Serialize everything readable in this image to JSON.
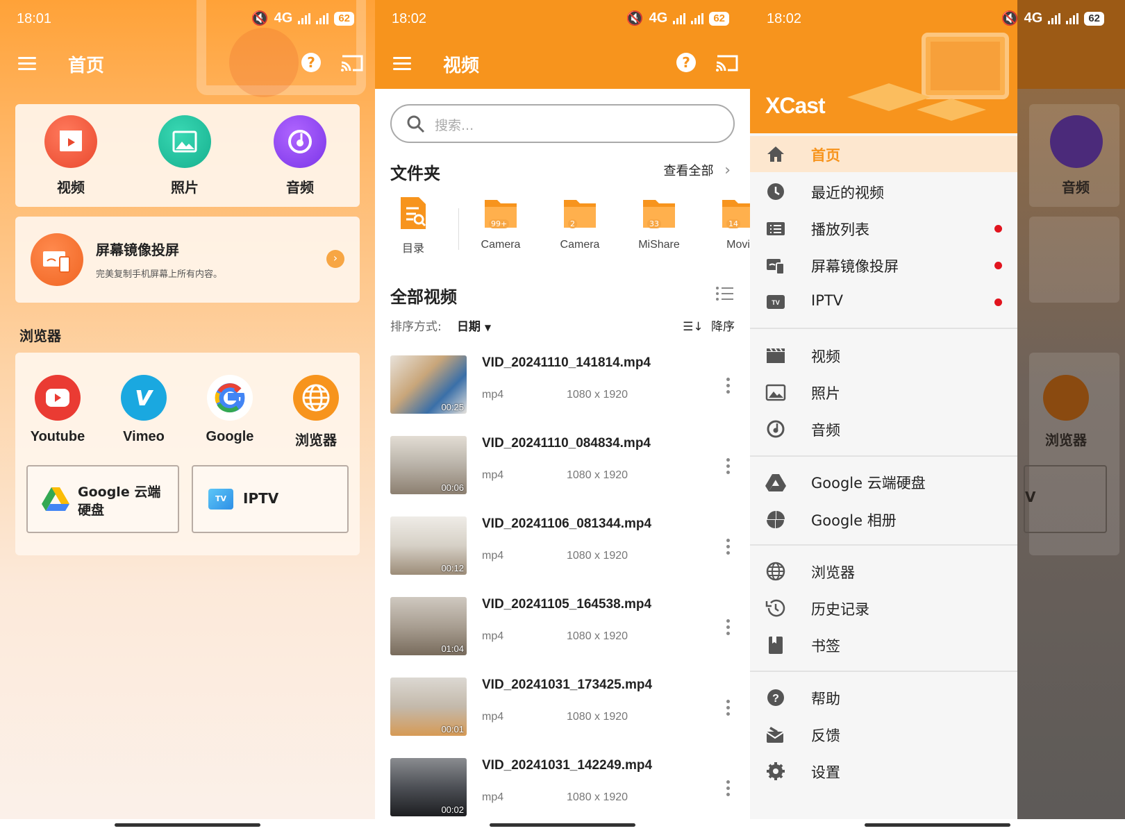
{
  "colors": {
    "accent": "#f7941d",
    "drawer_active_bg": "#fde7cf",
    "red_dot": "#e1141e"
  },
  "panel1": {
    "status": {
      "time": "18:01",
      "network": "4G",
      "battery": "62"
    },
    "title": "首页",
    "quick": [
      {
        "label": "视频",
        "icon": "video-clapper-icon"
      },
      {
        "label": "照片",
        "icon": "photo-icon"
      },
      {
        "label": "音频",
        "icon": "music-icon"
      }
    ],
    "mirror": {
      "title": "屏幕镜像投屏",
      "subtitle": "完美复制手机屏幕上所有内容。"
    },
    "browser_section": "浏览器",
    "browsers": [
      {
        "label": "Youtube",
        "icon": "youtube-icon"
      },
      {
        "label": "Vimeo",
        "icon": "vimeo-icon"
      },
      {
        "label": "Google",
        "icon": "google-icon"
      },
      {
        "label": "浏览器",
        "icon": "globe-icon"
      }
    ],
    "gdrive_label_line1": "Google 云端",
    "gdrive_label_line2": "硬盘",
    "iptv_label": "IPTV",
    "iptv_badge": "TV"
  },
  "panel2": {
    "status": {
      "time": "18:02",
      "network": "4G",
      "battery": "62"
    },
    "title": "视频",
    "search_placeholder": "搜索...",
    "folders_title": "文件夹",
    "view_all": "查看全部",
    "folders": [
      {
        "name": "目录",
        "count": ""
      },
      {
        "name": "Camera",
        "count": "99+"
      },
      {
        "name": "Camera",
        "count": "2"
      },
      {
        "name": "MiShare",
        "count": "33"
      },
      {
        "name": "Movi",
        "count": "14"
      }
    ],
    "all_videos_title": "全部视频",
    "sort_label": "排序方式:",
    "sort_value": "日期",
    "order_label": "降序",
    "videos": [
      {
        "name": "VID_20241110_141814.mp4",
        "format": "mp4",
        "resolution": "1080 x 1920",
        "duration": "00:25"
      },
      {
        "name": "VID_20241110_084834.mp4",
        "format": "mp4",
        "resolution": "1080 x 1920",
        "duration": "00:06"
      },
      {
        "name": "VID_20241106_081344.mp4",
        "format": "mp4",
        "resolution": "1080 x 1920",
        "duration": "00:12"
      },
      {
        "name": "VID_20241105_164538.mp4",
        "format": "mp4",
        "resolution": "1080 x 1920",
        "duration": "01:04"
      },
      {
        "name": "VID_20241031_173425.mp4",
        "format": "mp4",
        "resolution": "1080 x 1920",
        "duration": "00:01"
      },
      {
        "name": "VID_20241031_142249.mp4",
        "format": "mp4",
        "resolution": "1080 x 1920",
        "duration": "00:02"
      }
    ]
  },
  "panel3": {
    "status": {
      "time": "18:02",
      "network": "4G",
      "battery": "62"
    },
    "brand": "XCast",
    "bg_audio_label": "音频",
    "bg_browser_label": "浏览器",
    "bg_iptv_fragment": "V",
    "menu": [
      {
        "label": "首页",
        "icon": "home-icon",
        "active": true,
        "dot": false
      },
      {
        "label": "最近的视频",
        "icon": "clock-icon",
        "active": false,
        "dot": false
      },
      {
        "label": "播放列表",
        "icon": "playlist-icon",
        "active": false,
        "dot": true
      },
      {
        "label": "屏幕镜像投屏",
        "icon": "screen-mirror-icon",
        "active": false,
        "dot": true
      },
      {
        "label": "IPTV",
        "icon": "tv-icon",
        "active": false,
        "dot": true
      },
      {
        "label": "视频",
        "icon": "video-clapper-icon",
        "active": false,
        "dot": false
      },
      {
        "label": "照片",
        "icon": "photo-icon",
        "active": false,
        "dot": false
      },
      {
        "label": "音频",
        "icon": "music-icon",
        "active": false,
        "dot": false
      },
      {
        "label": "Google 云端硬盘",
        "icon": "google-drive-icon",
        "active": false,
        "dot": false
      },
      {
        "label": "Google 相册",
        "icon": "google-photos-icon",
        "active": false,
        "dot": false
      },
      {
        "label": "浏览器",
        "icon": "globe-icon",
        "active": false,
        "dot": false
      },
      {
        "label": "历史记录",
        "icon": "history-icon",
        "active": false,
        "dot": false
      },
      {
        "label": "书签",
        "icon": "bookmark-icon",
        "active": false,
        "dot": false
      },
      {
        "label": "帮助",
        "icon": "help-icon",
        "active": false,
        "dot": false
      },
      {
        "label": "反馈",
        "icon": "feedback-icon",
        "active": false,
        "dot": false
      },
      {
        "label": "设置",
        "icon": "settings-icon",
        "active": false,
        "dot": false
      }
    ]
  }
}
